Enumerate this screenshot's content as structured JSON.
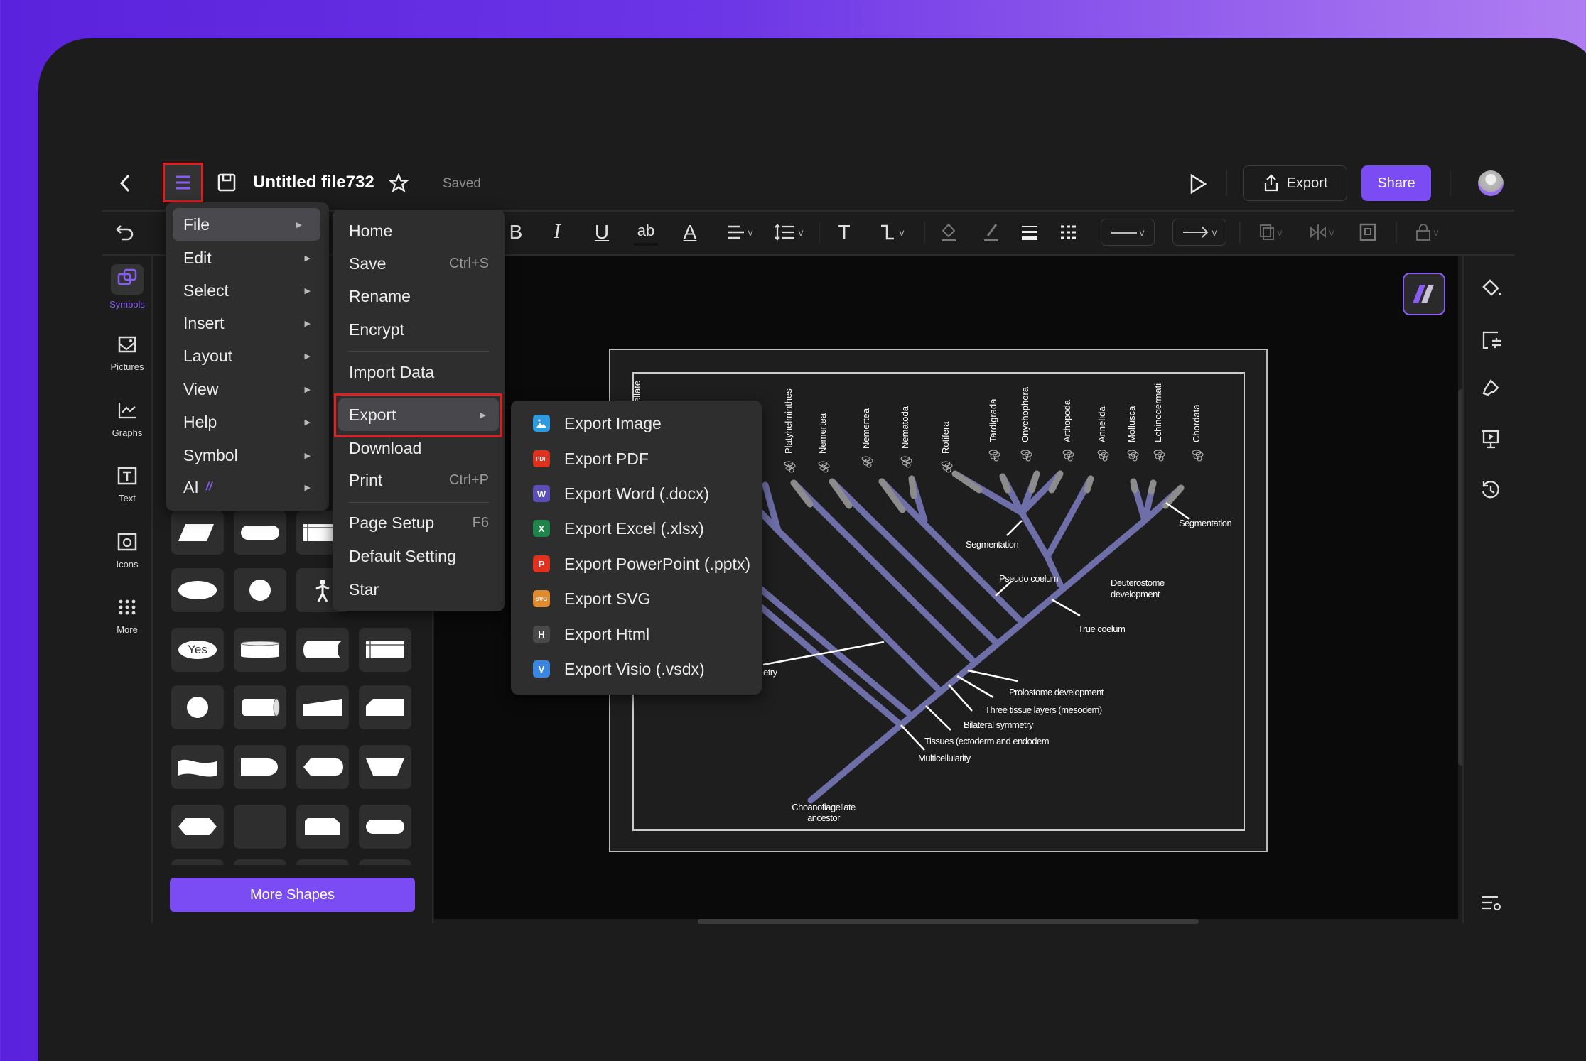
{
  "header": {
    "title": "Untitled file732",
    "status": "Saved",
    "export_label": "Export",
    "share_label": "Share"
  },
  "colors": {
    "accent": "#7b4cf4",
    "highlight_box": "#e02020",
    "branch": "#6e6ea8",
    "branch_tip": "#8c8c8c"
  },
  "sidebar": {
    "items": [
      {
        "label": "Symbols",
        "icon": "symbols-icon",
        "active": true
      },
      {
        "label": "Pictures",
        "icon": "pictures-icon"
      },
      {
        "label": "Graphs",
        "icon": "graphs-icon"
      },
      {
        "label": "Text",
        "icon": "text-icon"
      },
      {
        "label": "Icons",
        "icon": "icons-icon"
      },
      {
        "label": "More",
        "icon": "more-icon"
      }
    ]
  },
  "shapes": {
    "more_label": "More Shapes",
    "yes_label": "Yes",
    "tiles": [
      "parallelogram",
      "rounded-rect",
      "internal-storage",
      "",
      "ellipse",
      "circle",
      "actor",
      "",
      "terminator-yes",
      "database",
      "stored-data",
      "internal-storage",
      "circle",
      "direct-access",
      "manual-input",
      "card",
      "tape",
      "delay",
      "display",
      "manual-operation",
      "hexagon",
      "blank",
      "loop-limit",
      "capsule"
    ]
  },
  "main_menu": {
    "items": [
      {
        "label": "File"
      },
      {
        "label": "Edit"
      },
      {
        "label": "Select"
      },
      {
        "label": "Insert"
      },
      {
        "label": "Layout"
      },
      {
        "label": "View"
      },
      {
        "label": "Help"
      },
      {
        "label": "Symbol"
      },
      {
        "label": "AI"
      }
    ]
  },
  "file_menu": {
    "items": [
      {
        "label": "Home"
      },
      {
        "label": "Save",
        "shortcut": "Ctrl+S"
      },
      {
        "label": "Rename"
      },
      {
        "label": "Encrypt"
      },
      {
        "label": "Import Data"
      },
      {
        "label": "Export"
      },
      {
        "label": "Download"
      },
      {
        "label": "Print",
        "shortcut": "Ctrl+P"
      },
      {
        "label": "Page Setup",
        "shortcut": "F6"
      },
      {
        "label": "Default Setting"
      },
      {
        "label": "Star"
      }
    ]
  },
  "export_menu": {
    "items": [
      {
        "label": "Export Image",
        "icon": "image-icon",
        "badge": "",
        "color": "#2d9be0"
      },
      {
        "label": "Export PDF",
        "icon": "pdf-icon",
        "badge": "PDF",
        "color": "#e0301e"
      },
      {
        "label": "Export Word (.docx)",
        "icon": "word-icon",
        "badge": "W",
        "color": "#5a4fb8"
      },
      {
        "label": "Export Excel (.xlsx)",
        "icon": "excel-icon",
        "badge": "X",
        "color": "#1e8449"
      },
      {
        "label": "Export PowerPoint (.pptx)",
        "icon": "powerpoint-icon",
        "badge": "P",
        "color": "#e0301e"
      },
      {
        "label": "Export SVG",
        "icon": "svg-icon",
        "badge": "SVG",
        "color": "#e08a30"
      },
      {
        "label": "Export Html",
        "icon": "html-icon",
        "badge": "H",
        "color": "#4a4a4a"
      },
      {
        "label": "Export Visio (.vsdx)",
        "icon": "visio-icon",
        "badge": "V",
        "color": "#3a86e0"
      }
    ]
  },
  "diagram": {
    "taxa": [
      "ellate",
      "Platyhelminthes",
      "Nemertea",
      "Nemertea",
      "Nematoda",
      "Rotifera",
      "Tardigrada",
      "Onychophora",
      "Arthopoda",
      "Annelida",
      "Mollusca",
      "Echinodermati",
      "Chordata"
    ],
    "labels": {
      "seg1": "Segmentation",
      "seg2": "Segmentation",
      "pseudo": "Pseudo coelum",
      "deut1": "Deuterostome",
      "deut2": "development",
      "true": "True coelum",
      "radial": "etry",
      "proto": "Prolostome deveiopment",
      "three": "Three tissue layers (mesodem)",
      "bilat": "Bilateral symmetry",
      "tissues": "Tissues (ectoderm and endodem",
      "multi": "Multicellularity",
      "anc1": "Choanofiagellate",
      "anc2": "ancestor"
    }
  }
}
